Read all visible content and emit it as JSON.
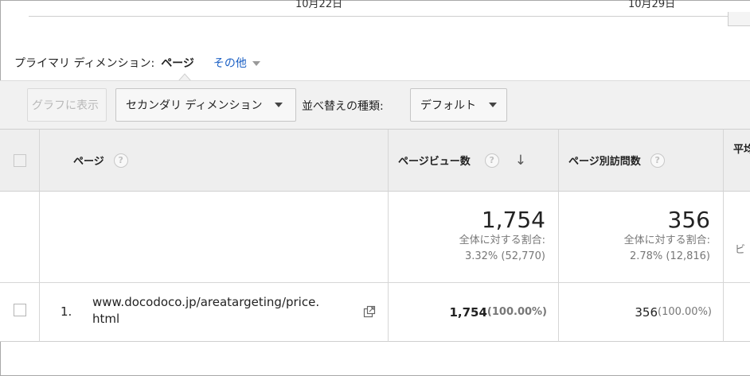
{
  "chart": {
    "date_labels": [
      "10月22日",
      "10月29日"
    ]
  },
  "primary_dimension": {
    "label": "プライマリ ディメンション:",
    "active": "ページ",
    "other": "その他"
  },
  "toolbar": {
    "graph_button": "グラフに表示",
    "secondary_dimension": "セカンダリ ディメンション",
    "sort_label": "並べ替えの種類:",
    "sort_value": "デフォルト"
  },
  "table": {
    "headers": {
      "page": "ページ",
      "pageviews": "ページビュー数",
      "unique_pageviews": "ページ別訪問数",
      "partial": "平均"
    },
    "help_glyph": "?",
    "sort_arrow": "↓",
    "totals": {
      "pageviews": {
        "value": "1,754",
        "share_label": "全体に対する割合:",
        "share": "3.32% (52,770)"
      },
      "unique_pageviews": {
        "value": "356",
        "share_label": "全体に対する割合:",
        "share": "2.78% (12,816)"
      },
      "partial_share": "ビ"
    },
    "rows": [
      {
        "index": "1.",
        "page_line1": "www.docodoco.jp/areatargeting/price.",
        "page_line2": "html",
        "pageviews": "1,754",
        "pageviews_pct": "(100.00%)",
        "unique_pageviews": "356",
        "unique_pageviews_pct": "(100.00%)"
      }
    ]
  }
}
